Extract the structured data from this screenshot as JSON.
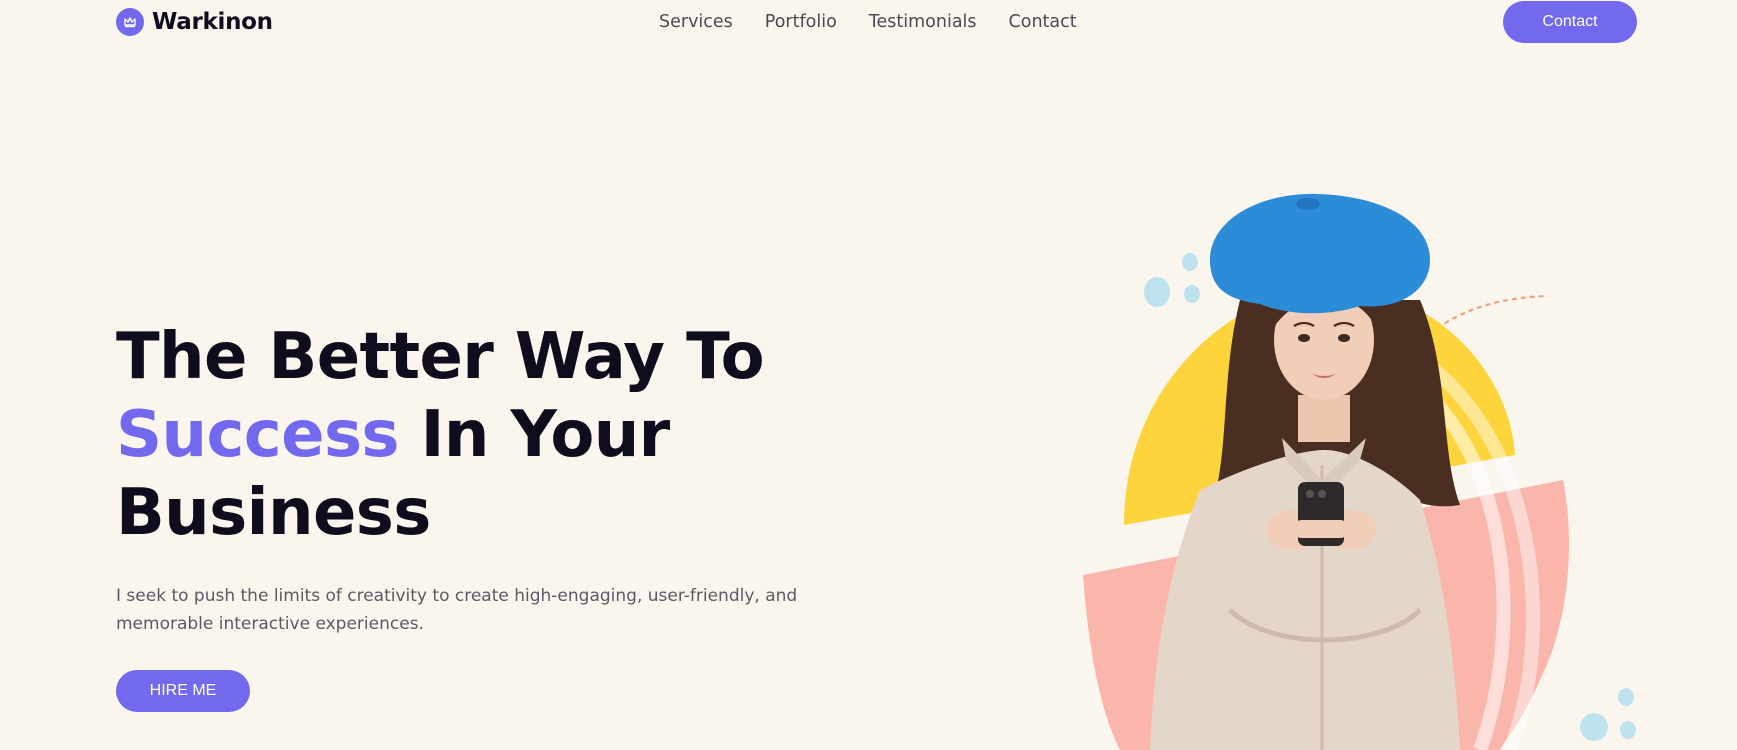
{
  "header": {
    "logo_text": "Warkinon",
    "nav": [
      {
        "label": "Services"
      },
      {
        "label": "Portfolio"
      },
      {
        "label": "Testimonials"
      },
      {
        "label": "Contact"
      }
    ],
    "contact_button": "Contact"
  },
  "hero": {
    "title_line1": "The Better Way To",
    "title_accent": "Success",
    "title_line2_rest": "In Your",
    "title_line3": "Business",
    "description": "I seek to push the limits of creativity to create high-engaging, user-friendly, and memorable interactive experiences.",
    "cta": "HIRE ME"
  },
  "colors": {
    "background": "#FAF6EE",
    "accent": "#7369EE",
    "heading": "#0F0D1D",
    "body_text": "#5A5A66",
    "yellow_shape": "#FDD43C",
    "pink_shape": "#FAB6AB",
    "bubbles": "#BFE2EF"
  },
  "icons": {
    "logo": "crown-icon"
  }
}
